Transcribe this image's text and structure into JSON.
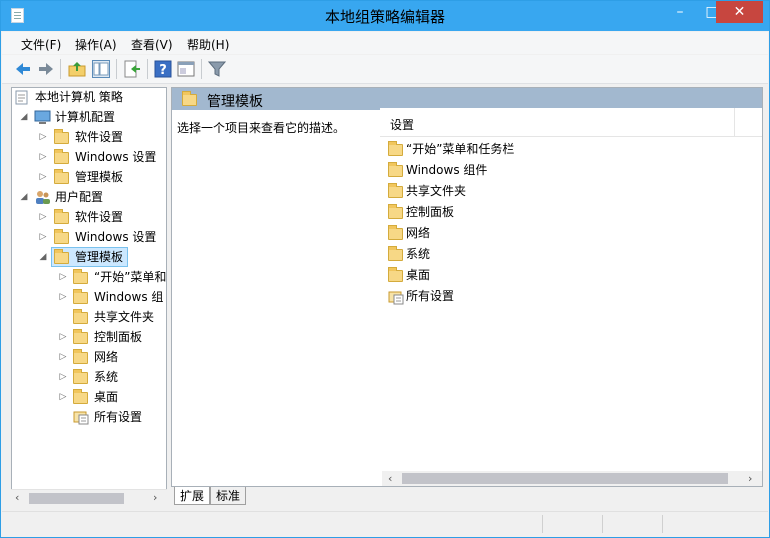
{
  "window": {
    "title": "本地组策略编辑器",
    "controls": {
      "minimize": "–",
      "maximize": "□",
      "close": "✕"
    }
  },
  "menu": {
    "items": [
      "文件(F)",
      "操作(A)",
      "查看(V)",
      "帮助(H)"
    ]
  },
  "toolbar": {
    "icons": [
      "back-arrow-icon",
      "forward-arrow-icon",
      "up-folder-icon",
      "show-tree-icon",
      "export-list-icon",
      "help-icon",
      "properties-icon",
      "filter-icon"
    ]
  },
  "tree": {
    "root": "本地计算机 策略",
    "computer_config": "计算机配置",
    "cc_software": "软件设置",
    "cc_windows": "Windows 设置",
    "cc_admin": "管理模板",
    "user_config": "用户配置",
    "uc_software": "软件设置",
    "uc_windows": "Windows 设置",
    "uc_admin": "管理模板",
    "uc_admin_children": [
      "“开始”菜单和",
      "Windows 组",
      "共享文件夹",
      "控制面板",
      "网络",
      "系统",
      "桌面",
      "所有设置"
    ]
  },
  "right_pane": {
    "header_title": "管理模板",
    "description": "选择一个项目来查看它的描述。",
    "column_header": "设置",
    "items": [
      "“开始”菜单和任务栏",
      "Windows 组件",
      "共享文件夹",
      "控制面板",
      "网络",
      "系统",
      "桌面",
      "所有设置"
    ]
  },
  "tabs": {
    "extended": "扩展",
    "standard": "标准"
  },
  "colors": {
    "titlebar": "#38a7f0",
    "close_button": "#c7463f",
    "header_band": "#a2b8cf",
    "selection": "#cce8ff"
  }
}
